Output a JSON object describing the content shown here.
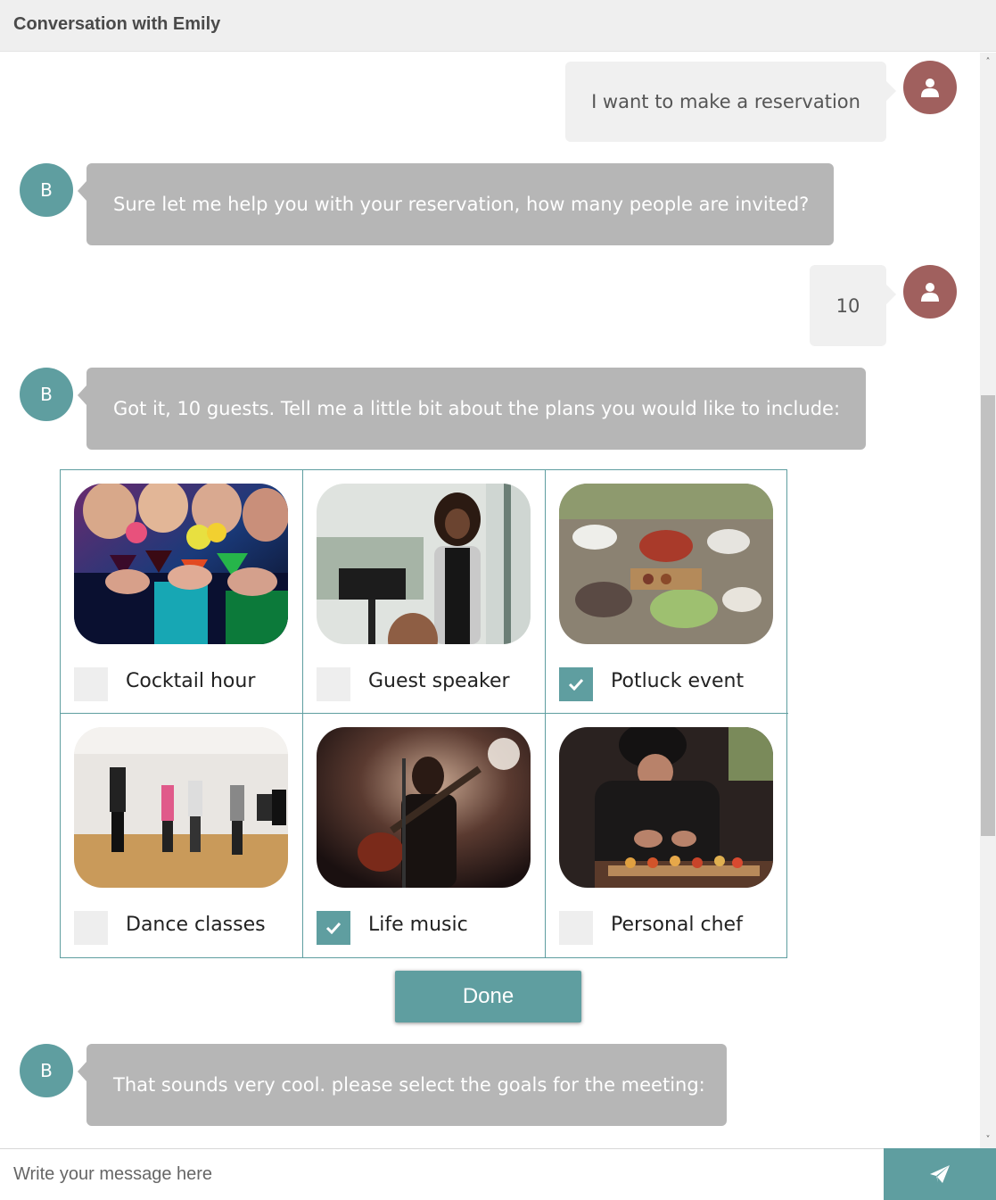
{
  "header": {
    "title": "Conversation with Emily"
  },
  "theme": {
    "accent": "#5f9ea0",
    "user_avatar": "#a0605e",
    "bot_bubble": "#b6b6b6",
    "user_bubble": "#f0f0f0"
  },
  "messages": [
    {
      "sender": "user",
      "text": "I want to make a reservation"
    },
    {
      "sender": "bot",
      "avatar_letter": "B",
      "text": "Sure let me help you with your reservation, how many people are invited?"
    },
    {
      "sender": "user",
      "text": "10"
    },
    {
      "sender": "bot",
      "avatar_letter": "B",
      "text": "Got it, 10 guests. Tell me a little bit about the plans you would like to include:"
    },
    {
      "sender": "bot",
      "avatar_letter": "B",
      "text": "That sounds very cool. please select the goals for the meeting:"
    }
  ],
  "plan_options": [
    {
      "label": "Cocktail hour",
      "checked": false,
      "image": "people toasting colorful cocktails"
    },
    {
      "label": "Guest speaker",
      "checked": false,
      "image": "woman speaking at a podium"
    },
    {
      "label": "Potluck event",
      "checked": true,
      "image": "shared food on a wooden table"
    },
    {
      "label": "Dance classes",
      "checked": false,
      "image": "group dancing in a studio"
    },
    {
      "label": "Life music",
      "checked": true,
      "image": "guitarist singing on stage"
    },
    {
      "label": "Personal chef",
      "checked": false,
      "image": "chef plating appetizers"
    }
  ],
  "done_button": {
    "label": "Done"
  },
  "composer": {
    "placeholder": "Write your message here",
    "value": ""
  },
  "icons": {
    "user_avatar": "user-icon",
    "send": "paper-plane-icon",
    "checkbox_checked": "checkmark-icon"
  }
}
